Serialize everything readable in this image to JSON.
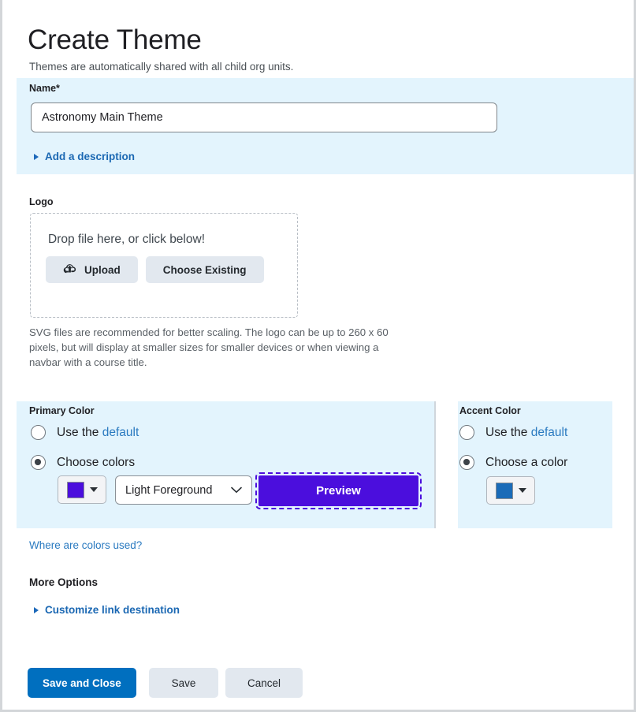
{
  "page": {
    "title": "Create Theme",
    "subtitle": "Themes are automatically shared with all child org units."
  },
  "name_field": {
    "label": "Name",
    "required_marker": "*",
    "value": "Astronomy Main Theme",
    "placeholder": "",
    "description_toggle": "Add a description",
    "description_toggle_icon": "triangle-right-icon",
    "panel_color": "#e3f4fd"
  },
  "logo": {
    "label": "Logo",
    "dropzone_text": "Drop file here, or click below!",
    "upload_label": "Upload",
    "upload_icon": "cloud-upload-icon",
    "choose_existing_label": "Choose Existing",
    "helper_text": "SVG files are recommended for better scaling. The logo can be up to 260 x 60 pixels, but will display at smaller sizes for smaller devices or when viewing a navbar with a course title."
  },
  "primary_color": {
    "label": "Primary Color",
    "option_default": {
      "text_prefix": "Use the ",
      "link_text": "default",
      "selected": false
    },
    "option_choose": {
      "text": "Choose colors",
      "selected": true
    },
    "swatch_color": "#4b0edd",
    "swatch_icon": "color-swatch-caret-icon",
    "foreground_select_value": "Light Foreground",
    "foreground_select_icon": "chevron-down-icon",
    "preview_button_label": "Preview",
    "preview_button_color": "#4b0edd",
    "panel_color": "#e3f4fd"
  },
  "accent_color": {
    "label": "Accent Color",
    "option_default": {
      "text_prefix": "Use the ",
      "link_text": "default",
      "selected": false
    },
    "option_choose": {
      "text": "Choose a color",
      "selected": true
    },
    "swatch_color": "#1a6bb8",
    "swatch_icon": "color-swatch-caret-icon",
    "panel_color": "#e3f4fd"
  },
  "links": {
    "where_are_colors_used": "Where are colors used?"
  },
  "more_options": {
    "heading": "More Options",
    "customize_link_destination": "Customize link destination",
    "customize_icon": "triangle-right-icon"
  },
  "footer": {
    "save_and_close_label": "Save and Close",
    "save_label": "Save",
    "cancel_label": "Cancel",
    "primary_button_color": "#006fbf"
  }
}
